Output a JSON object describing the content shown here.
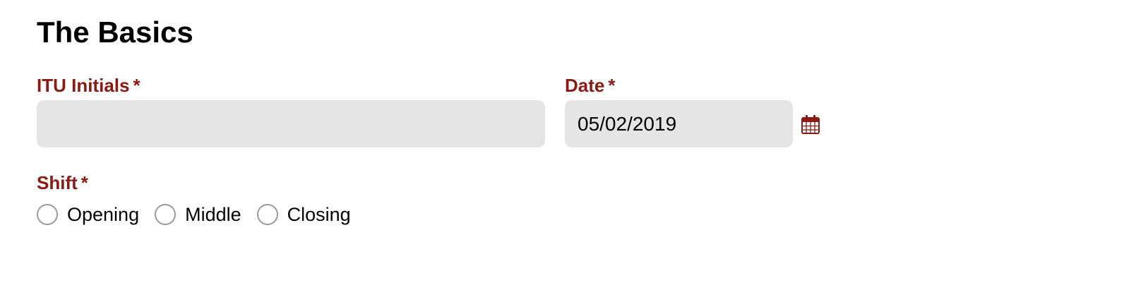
{
  "section": {
    "title": "The Basics"
  },
  "fields": {
    "initials": {
      "label": "ITU Initials",
      "required_mark": "*",
      "value": ""
    },
    "date": {
      "label": "Date",
      "required_mark": "*",
      "value": "05/02/2019",
      "icon": "calendar-icon"
    },
    "shift": {
      "label": "Shift",
      "required_mark": "*",
      "options": [
        {
          "label": "Opening",
          "selected": false
        },
        {
          "label": "Middle",
          "selected": false
        },
        {
          "label": "Closing",
          "selected": false
        }
      ]
    }
  },
  "colors": {
    "label": "#8b1a12",
    "input_bg": "#e5e5e5",
    "radio_border": "#9a9a9a"
  }
}
